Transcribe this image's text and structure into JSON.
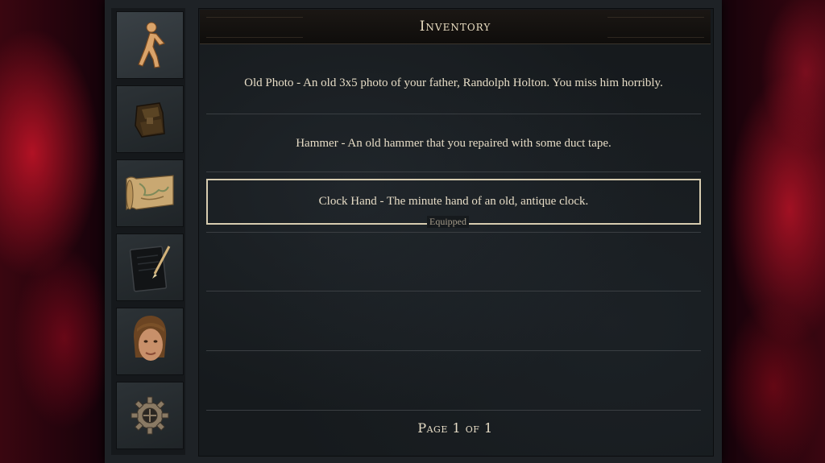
{
  "window": {
    "title": "Inventory"
  },
  "sidebar": {
    "tabs": [
      {
        "name": "walk",
        "icon": "walking-figure-icon",
        "active": true
      },
      {
        "name": "inventory",
        "icon": "bag-icon",
        "active": false
      },
      {
        "name": "map",
        "icon": "map-scroll-icon",
        "active": false
      },
      {
        "name": "journal",
        "icon": "notebook-pen-icon",
        "active": false
      },
      {
        "name": "character",
        "icon": "portrait-icon",
        "active": false
      },
      {
        "name": "settings",
        "icon": "gear-icon",
        "active": false
      }
    ]
  },
  "inventory": {
    "items": [
      {
        "text": "Old Photo - An old 3x5 photo of your father, Randolph Holton.  You miss him horribly."
      },
      {
        "text": "Hammer - An old hammer that you repaired with some duct tape."
      },
      {
        "text": "Clock Hand - The minute hand of an old, antique clock.",
        "equipped": true
      }
    ],
    "equipped_label": "Equipped",
    "page_label": "Page 1 of 1"
  },
  "colors": {
    "text": "#e6dcc6",
    "accent_border": "#d7ccb0",
    "panel": "#161a1d"
  }
}
